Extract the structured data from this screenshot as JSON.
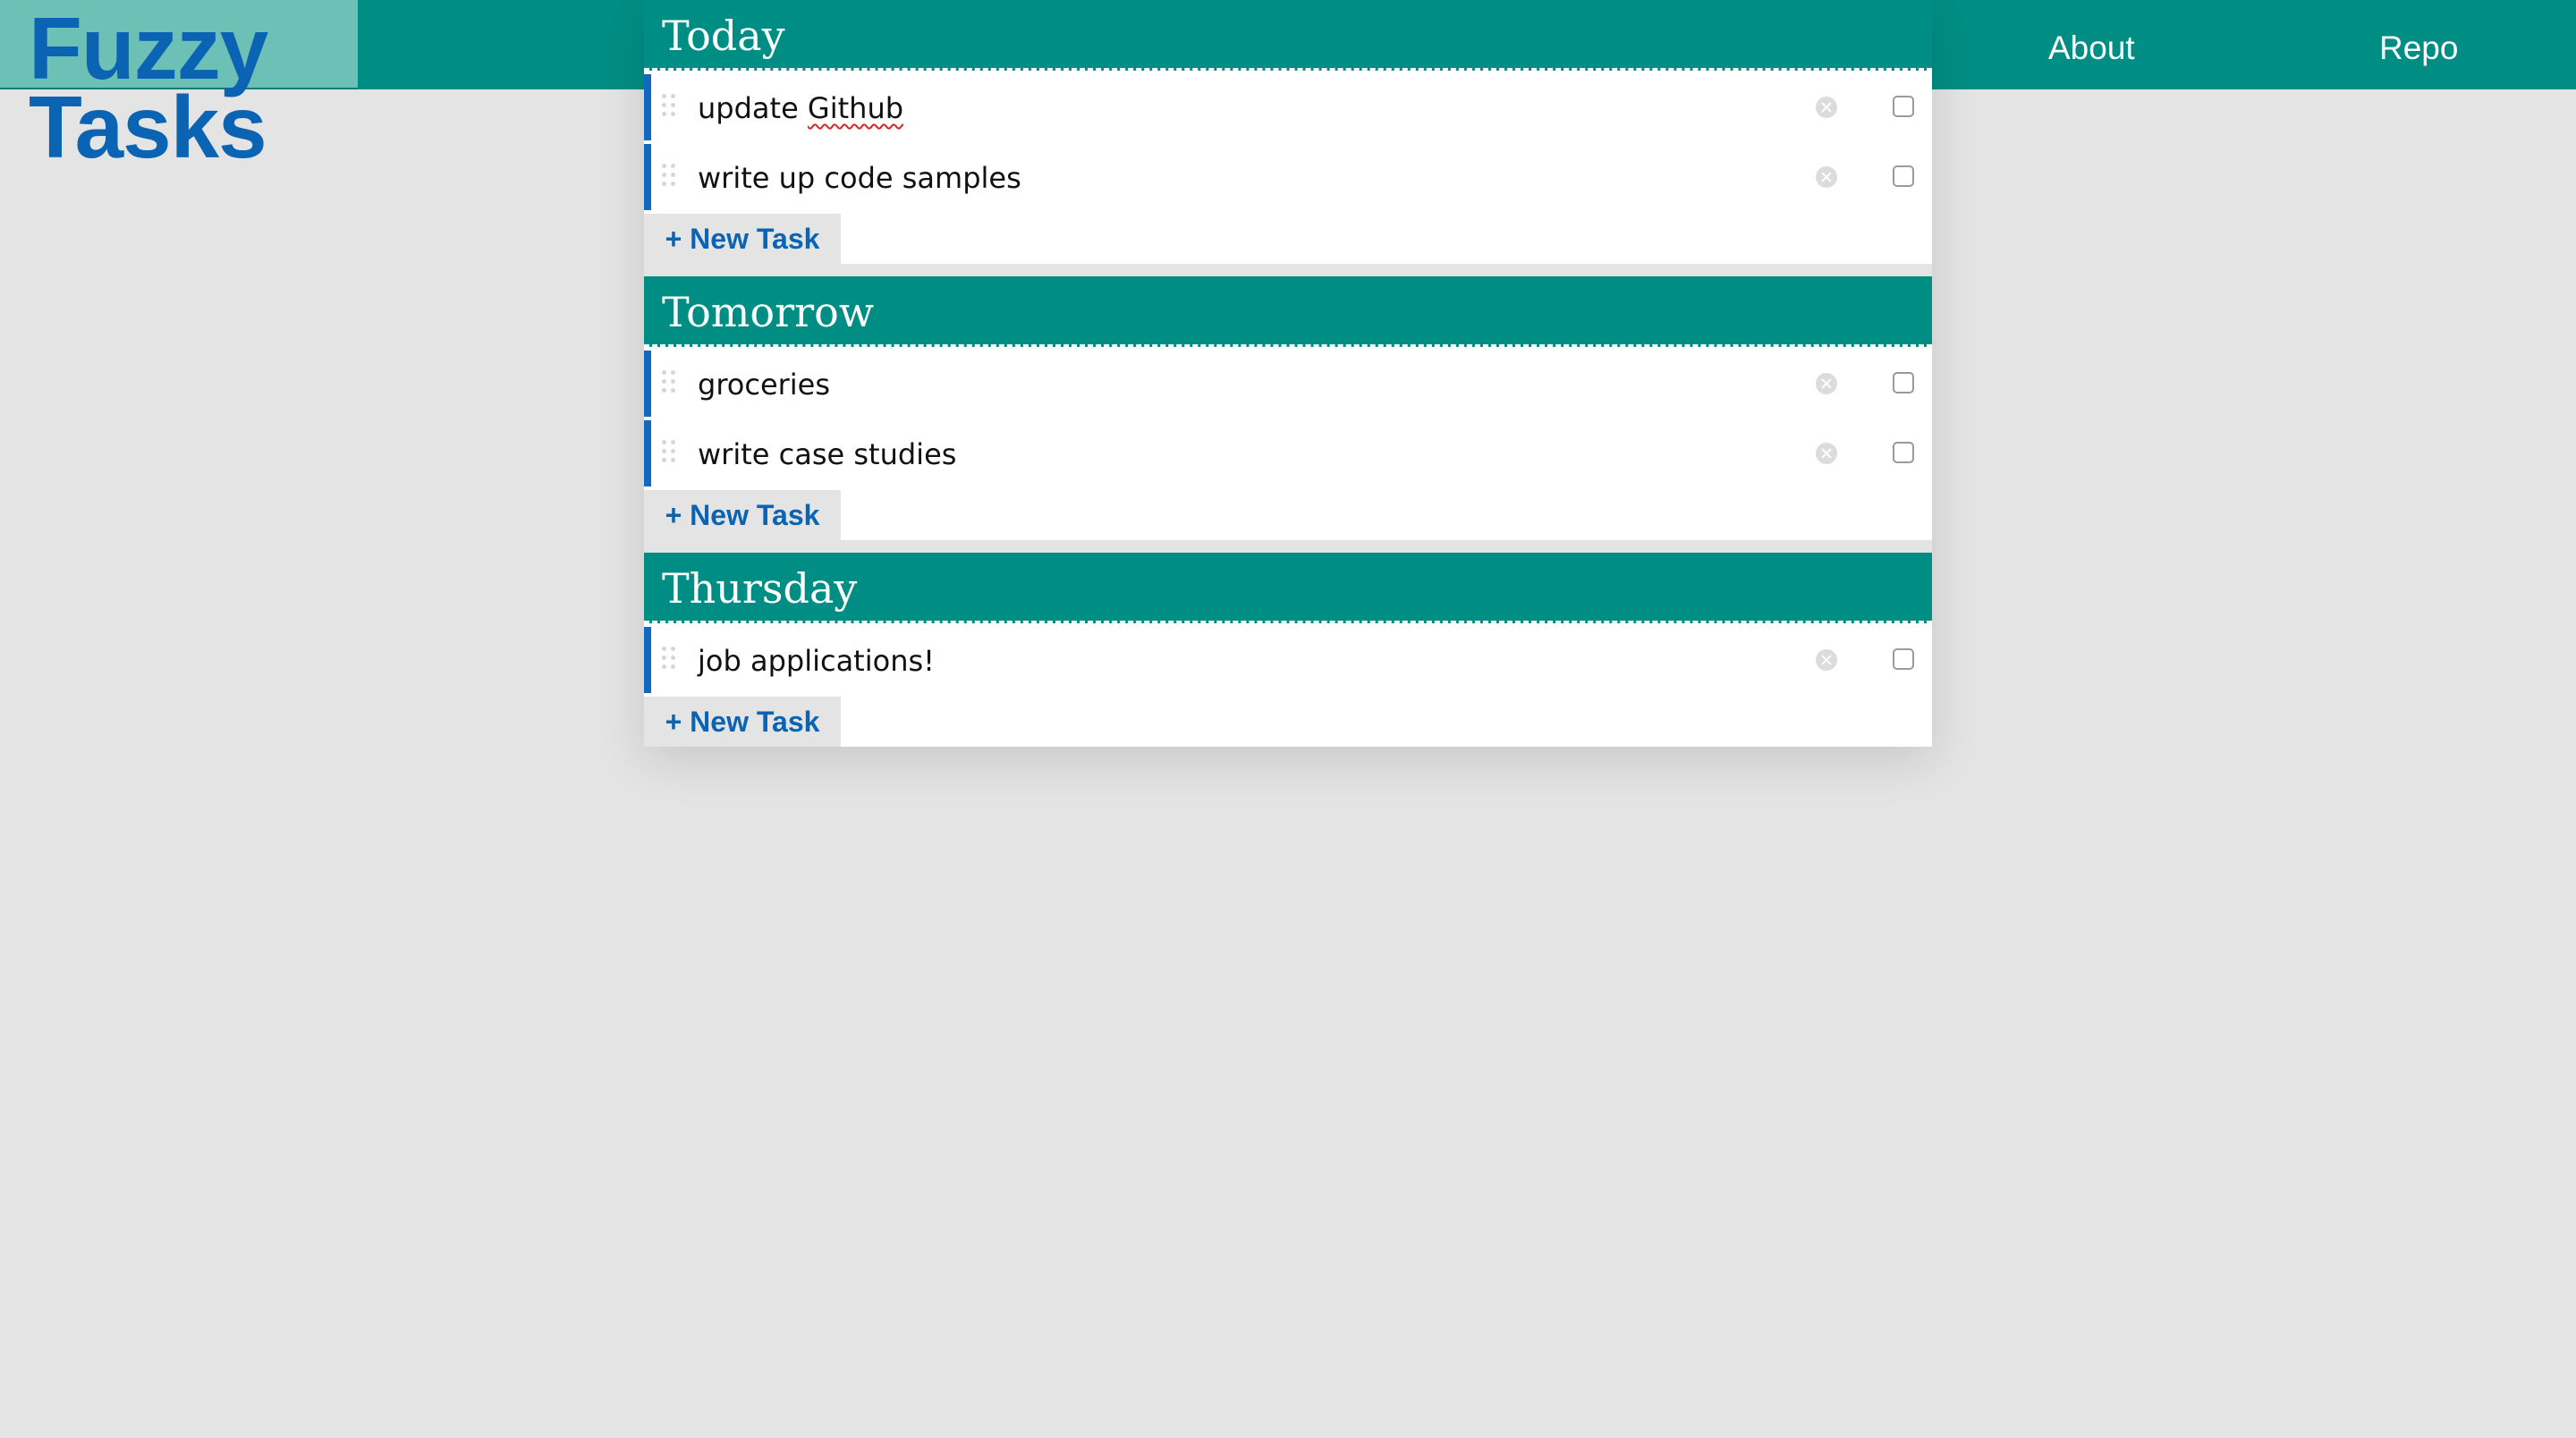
{
  "app": {
    "logo_line1": "Fuzzy",
    "logo_line2": "Tasks"
  },
  "nav": {
    "about": "About",
    "repo": "Repo"
  },
  "colors": {
    "header": "#008e84",
    "logo_bg": "#6dc0b5",
    "accent": "#0a63b3",
    "page_bg": "#e4e4e4"
  },
  "days": [
    {
      "title": "Today",
      "tasks": [
        {
          "text_before": "update ",
          "text_spell": "Github",
          "text": "update Github",
          "done": false
        },
        {
          "text": "write up code samples",
          "done": false
        }
      ],
      "new_task_label": "+ New Task"
    },
    {
      "title": "Tomorrow",
      "tasks": [
        {
          "text": "groceries",
          "done": false
        },
        {
          "text": "write case studies",
          "done": false
        }
      ],
      "new_task_label": "+ New Task"
    },
    {
      "title": "Thursday",
      "tasks": [
        {
          "text": "job applications!",
          "done": false
        }
      ],
      "new_task_label": "+ New Task"
    }
  ],
  "icons": {
    "grip": "drag-handle-icon",
    "delete": "close-circle-icon",
    "checkbox": "checkbox-icon"
  }
}
